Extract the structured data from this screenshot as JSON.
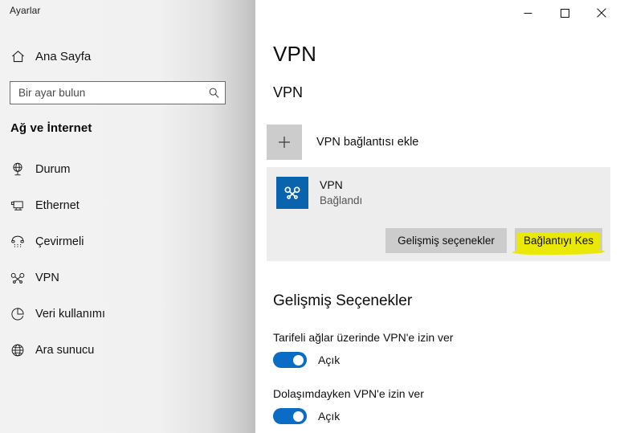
{
  "window": {
    "title": "Ayarlar",
    "controls": [
      {
        "name": "minimize-button",
        "glyph": "minimize"
      },
      {
        "name": "maximize-button",
        "glyph": "maximize"
      },
      {
        "name": "close-button",
        "glyph": "close"
      }
    ]
  },
  "sidebar": {
    "home_label": "Ana Sayfa",
    "home_icon": "home-icon",
    "search": {
      "placeholder": "Bir ayar bulun",
      "value": "",
      "icon": "search-icon"
    },
    "category_title": "Ağ ve İnternet",
    "items": [
      {
        "label": "Durum",
        "icon": "network-status-icon",
        "selected": false
      },
      {
        "label": "Ethernet",
        "icon": "ethernet-icon",
        "selected": false
      },
      {
        "label": "Çevirmeli",
        "icon": "dialup-phone-icon",
        "selected": false
      },
      {
        "label": "VPN",
        "icon": "vpn-icon",
        "selected": true
      },
      {
        "label": "Veri kullanımı",
        "icon": "data-usage-pie-icon",
        "selected": false
      },
      {
        "label": "Ara sunucu",
        "icon": "proxy-globe-icon",
        "selected": false
      }
    ]
  },
  "main": {
    "page_title": "VPN",
    "section_heading": "VPN",
    "add_connection": {
      "label": "VPN bağlantısı ekle",
      "icon": "plus-icon"
    },
    "connection": {
      "icon": "vpn-connection-icon",
      "name": "VPN",
      "status": "Bağlandı",
      "advanced_button": "Gelişmiş seçenekler",
      "disconnect_button": "Bağlantıyı Kes",
      "disconnect_highlighted": true
    },
    "advanced": {
      "title": "Gelişmiş Seçenekler",
      "options": [
        {
          "label": "Tarifeli ağlar üzerinde VPN'e izin ver",
          "state": "Açık",
          "on": true
        },
        {
          "label": "Dolaşımdayken VPN'e izin ver",
          "state": "Açık",
          "on": true
        }
      ]
    }
  },
  "colors": {
    "accent": "#0a6cc4",
    "vpn_tile": "#0a64ad",
    "card_bg": "#ededed",
    "button_bg": "#cccccc",
    "highlight": "#eae906"
  }
}
